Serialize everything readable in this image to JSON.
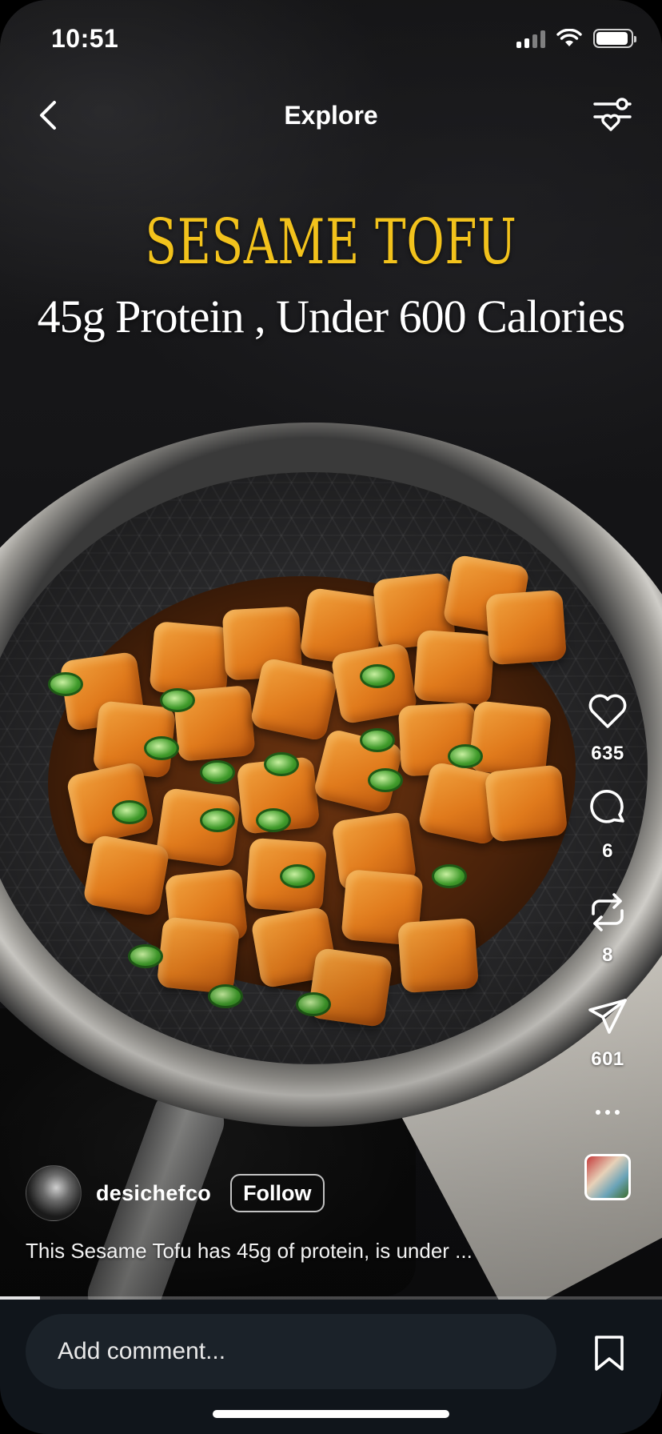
{
  "status_bar": {
    "time": "10:51",
    "battery_level": 0.92
  },
  "header": {
    "title": "Explore",
    "back_icon": "chevron-left-icon",
    "filter_icon": "sliders-heart-icon"
  },
  "post": {
    "overlay_title": "SESAME TOFU",
    "overlay_subtitle": "45g Protein , Under 600 Calories",
    "author": {
      "username": "desichefco",
      "follow_label": "Follow"
    },
    "caption": "This Sesame Tofu has 45g of protein, is under ...",
    "progress": 0.06
  },
  "actions": {
    "likes": "635",
    "comments": "6",
    "reposts": "8",
    "shares": "601"
  },
  "comment_bar": {
    "placeholder": "Add comment..."
  },
  "colors": {
    "accent_title": "#f2c21c",
    "bottom_bar": "#10151b",
    "comment_field": "#1b2229"
  }
}
